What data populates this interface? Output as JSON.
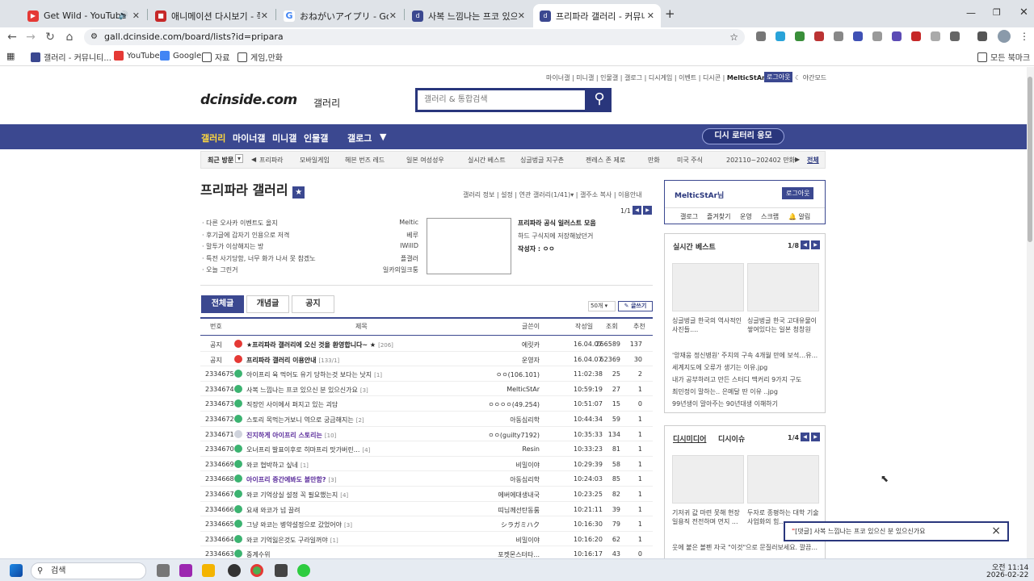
{
  "browser": {
    "tabs": [
      {
        "title": "Get Wild - YouTube",
        "icon": "youtube-icon",
        "color": "#e53935"
      },
      {
        "title": "애니메이션 다시보기 - 쭉쭉티비",
        "icon": "tv-icon",
        "color": "#c62828"
      },
      {
        "title": "おねがいアイプリ - Google 検索",
        "icon": "google-icon",
        "color": "#4285f4"
      },
      {
        "title": "사복 느낌나는 프코 있으신 분",
        "icon": "dc-icon",
        "color": "#3b4890"
      },
      {
        "title": "프리파라 갤러리 - 커뮤니티 포털",
        "icon": "dc-icon",
        "color": "#3b4890"
      }
    ],
    "new_tab": "+",
    "url": "gall.dcinside.com/board/lists?id=pripara",
    "bookmarks": [
      "갤러리 - 커뮤니티...",
      "YouTube",
      "Google",
      "자료",
      "게임,만화"
    ],
    "all_bookmarks": "모든 북마크"
  },
  "site": {
    "top_links": [
      "마이너갤",
      "미니갤",
      "인물갤",
      "갤로그",
      "디시게임",
      "이벤트",
      "디시콘"
    ],
    "user_link": "MelticStAr님",
    "logout_btn": "로그아웃",
    "night_mode": "야간모드",
    "logo": "dcinside.com",
    "logo_sub": "갤러리",
    "search_placeholder": "갤러리 & 통합검색",
    "gnb": [
      "갤러리",
      "마이너갤",
      "미니갤",
      "인물갤",
      "갤로그"
    ],
    "lotto_btn": "디시 로터리 응모",
    "recent_label": "최근 방문",
    "recent_items": [
      "프리파라",
      "모바일게임",
      "헤븐 번즈 레드",
      "일본 여성성우",
      "실시간 베스트",
      "싱글벙글 지구촌",
      "젠레스 존 제로",
      "만화",
      "미국 주식",
      "202110~202402 만화"
    ],
    "recent_all": "전체"
  },
  "gallery": {
    "title": "프리파라 갤러리",
    "menu": [
      "갤러리 정보",
      "설정",
      "연관 갤러리(1/41)",
      "갤주소 복사",
      "이용안내"
    ],
    "page_indicator": "1/1",
    "notices": [
      {
        "text": "· 다른 오사카 이벤트도 올지",
        "author": "Meltic"
      },
      {
        "text": "· 후기글에 갑자기 인용으로 저격",
        "author": "베루"
      },
      {
        "text": "· 말투가 이상해지는 방",
        "author": "IWillD"
      },
      {
        "text": "· 특전 사기당함, 너무 화가 나서 못 참겠노",
        "author": "플갤러"
      },
      {
        "text": "· 오늘 그린거",
        "author": "일카의일크퉁"
      }
    ],
    "featured": {
      "title": "프리파라 공식 일러스트 모음",
      "sub": "하드 구식지에 저장해놨던거",
      "author": "작성자 : ㅇㅇ"
    },
    "tabs": [
      "전체글",
      "개념글",
      "공지"
    ],
    "per_page": "50개",
    "write_btn": "글쓰기",
    "columns": [
      "번호",
      "제목",
      "글쓴이",
      "작성일",
      "조회",
      "추천"
    ],
    "rows": [
      {
        "no": "공지",
        "title": "★프리파라 갤러리에 오신 것을 환영합니다~ ★",
        "cnt": "[206]",
        "writer": "에릿카",
        "date": "16.04.07",
        "views": "266589",
        "rec": "137",
        "icon": "notice",
        "bold": true
      },
      {
        "no": "공지",
        "title": "프리파라 갤러리 이용안내",
        "cnt": "[133/1]",
        "writer": "운영자",
        "date": "16.04.07",
        "views": "62369",
        "rec": "30",
        "icon": "notice",
        "bold": true
      },
      {
        "no": "2334675",
        "title": "아이프리 육 먹어도 유기 당하는것 보다는 낫지",
        "cnt": "[1]",
        "writer": "ㅇㅇ(106.101)",
        "date": "11:02:38",
        "views": "25",
        "rec": "2",
        "icon": "normal"
      },
      {
        "no": "2334674",
        "title": "사복 느낌나는 프코 있으신 분 있으신가요",
        "cnt": "[3]",
        "writer": "MelticStAr",
        "date": "10:59:19",
        "views": "27",
        "rec": "1",
        "icon": "normal"
      },
      {
        "no": "2334673",
        "title": "직장인 사이에서 퍼지고 있는 괴담",
        "cnt": "",
        "writer": "ㅇㅇㅇㅇ(49.254)",
        "date": "10:51:07",
        "views": "15",
        "rec": "0",
        "icon": "normal"
      },
      {
        "no": "2334672",
        "title": "스토리 목먹는거보니 역으로 궁금해지는",
        "cnt": "[2]",
        "writer": "아동심리학",
        "date": "10:44:34",
        "views": "59",
        "rec": "1",
        "icon": "normal"
      },
      {
        "no": "2334671",
        "title": "진지하게 아이프리 스토리는",
        "cnt": "[10]",
        "writer": "ㅇㅇ(guilty7192)",
        "date": "10:35:33",
        "views": "134",
        "rec": "1",
        "icon": "hot",
        "purple": true
      },
      {
        "no": "2334670",
        "title": "오너프리 발표이후로 히마프리 맛가버린...",
        "cnt": "[4]",
        "writer": "Resin",
        "date": "10:33:23",
        "views": "81",
        "rec": "1",
        "icon": "normal"
      },
      {
        "no": "2334669",
        "title": "와코 협박하고 싶네",
        "cnt": "[1]",
        "writer": "비밀이야",
        "date": "10:29:39",
        "views": "58",
        "rec": "1",
        "icon": "normal"
      },
      {
        "no": "2334668",
        "title": "아이프리 중간에봐도 볼만함?",
        "cnt": "[3]",
        "writer": "아동심리학",
        "date": "10:24:03",
        "views": "85",
        "rec": "1",
        "icon": "normal",
        "purple": true
      },
      {
        "no": "2334667",
        "title": "와코 기억상실 설정 꼭 필요했는지",
        "cnt": "[4]",
        "writer": "에버에대생내국",
        "date": "10:23:25",
        "views": "82",
        "rec": "1",
        "icon": "normal"
      },
      {
        "no": "2334666",
        "title": "요새 와코가 넘 끌려",
        "cnt": "",
        "writer": "띠님께선탄동룸",
        "date": "10:21:11",
        "views": "39",
        "rec": "1",
        "icon": "normal"
      },
      {
        "no": "2334665",
        "title": "그냥 와코는 병약설정으로 갔었어야",
        "cnt": "[3]",
        "writer": "シラガミハク",
        "date": "10:16:30",
        "views": "79",
        "rec": "1",
        "icon": "normal"
      },
      {
        "no": "2334664",
        "title": "와코 기억잃은것도 구라일꺼야",
        "cnt": "[1]",
        "writer": "비밀이야",
        "date": "10:16:20",
        "views": "62",
        "rec": "1",
        "icon": "normal"
      },
      {
        "no": "2334663",
        "title": "중계수위",
        "cnt": "",
        "writer": "포켓몬스터타...",
        "date": "10:16:17",
        "views": "43",
        "rec": "0",
        "icon": "normal"
      }
    ]
  },
  "sidebar": {
    "user": "MelticStAr님",
    "logout": "로그아웃",
    "links": [
      "갤로그",
      "즐겨찾기",
      "운영",
      "스크랩",
      "알림"
    ],
    "best_title": "실시간 베스트",
    "best_page": "1/8",
    "best_thumbs": [
      "싱글벙글 한국의 역사적인 사진들....",
      "싱글벙글 한국 고대유물이 쌓여있다는 일본 청창원"
    ],
    "best_list": [
      "'앙재웅 정신병원' 주치의 구속 4개월 만에 보석…유...",
      "세계지도에 오류가 생기는 이유.jpg",
      "내가 공부하려고 만든 스터디 맥커리 9가지 구도",
      "최민정이 말하는.. 은메달 딴 이유 ..jpg",
      "99년생이 말아주는 90년대생 이해하기"
    ],
    "media_tabs": [
      "디시미디어",
      "디시이슈"
    ],
    "media_page": "1/4",
    "media_thumbs": [
      "기저귀 값 마련 못해 현장 일용직 전전하며 먼지 ...",
      "두자로 종평하는 대학 기술 사업화의 힘..."
    ],
    "media_more": "웃에 붙은 볼펜 자국 \"이것\"으로 문질러보세요. 깔끔..."
  },
  "toast": {
    "text": "[댓글] 사복 느낌나는 프코 있으신 분 있으신가요",
    "close": "×"
  },
  "taskbar": {
    "search": "검색",
    "time": "오전 11:14",
    "date": "2026-02-22"
  },
  "colors": {
    "brand": "#3b4890",
    "brand_dark": "#29367c",
    "notice": "#e53935",
    "normal_icon": "#3cb371",
    "purple_title": "#5b2d9c"
  }
}
